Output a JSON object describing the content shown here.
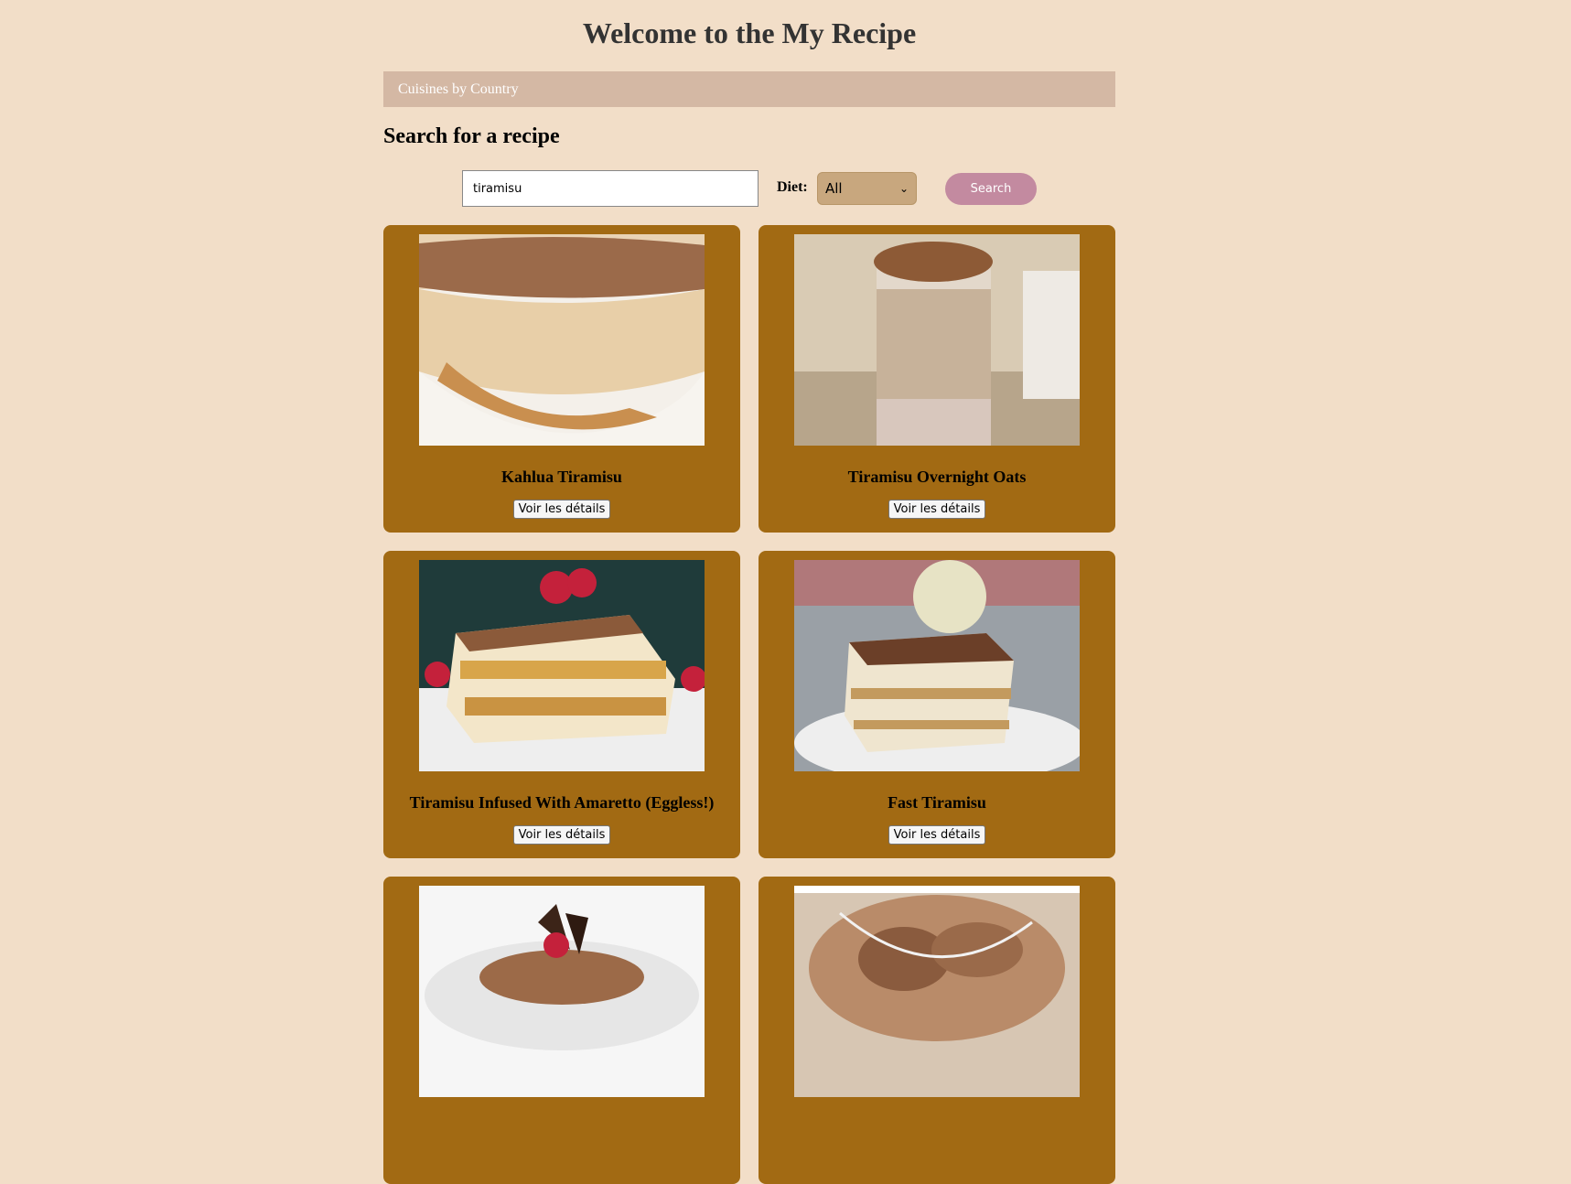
{
  "header": {
    "title": "Welcome to the My Recipe"
  },
  "nav": {
    "items": [
      {
        "label": "Cuisines by Country"
      }
    ]
  },
  "search": {
    "heading": "Search for a recipe",
    "query": "tiramisu",
    "diet_label": "Diet:",
    "diet_selected": "All",
    "button_label": "Search"
  },
  "results": [
    {
      "title": "Kahlua Tiramisu",
      "button_label": "Voir les détails"
    },
    {
      "title": "Tiramisu Overnight Oats",
      "button_label": "Voir les détails"
    },
    {
      "title": "Tiramisu Infused With Amaretto (Eggless!)",
      "button_label": "Voir les détails"
    },
    {
      "title": "Fast Tiramisu",
      "button_label": "Voir les détails"
    },
    {
      "title": "",
      "button_label": ""
    },
    {
      "title": "",
      "button_label": ""
    }
  ],
  "colors": {
    "page_bg": "#f2dec8",
    "nav_bg": "#d4b8a4",
    "card_bg": "#a26a13",
    "search_button_bg": "#c38aa0",
    "select_bg": "#c8a77e"
  }
}
